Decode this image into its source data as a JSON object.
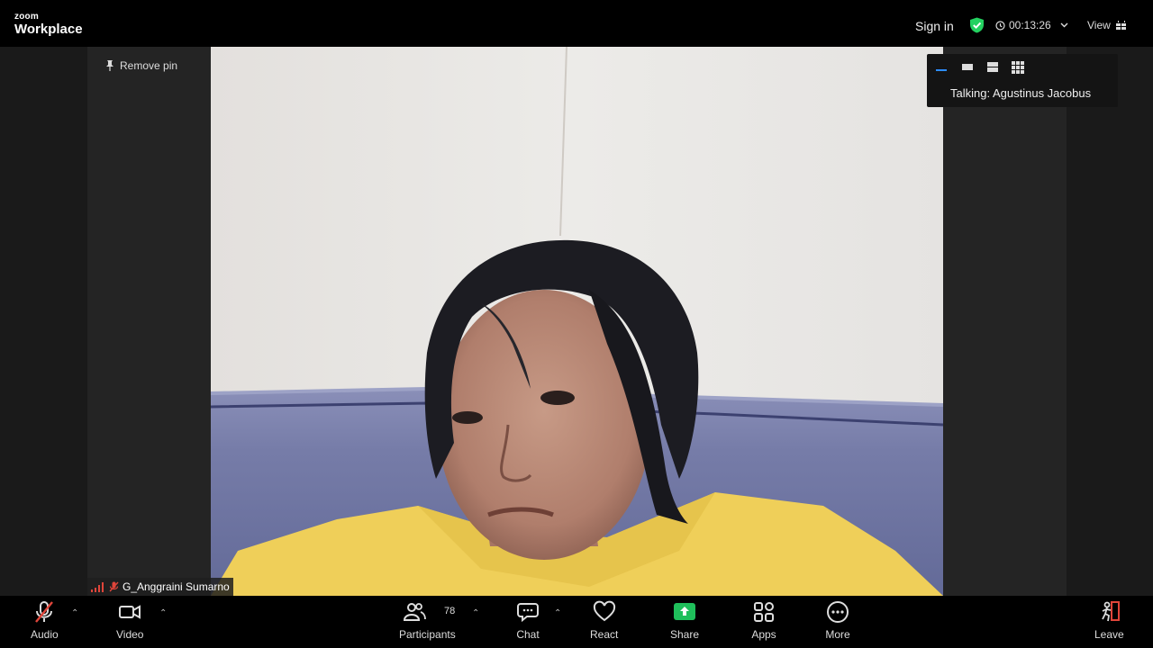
{
  "app": {
    "brand_small": "zoom",
    "brand_big": "Workplace"
  },
  "topbar": {
    "sign_in": "Sign in",
    "timer": "00:13:26",
    "view_label": "View"
  },
  "pin": {
    "remove_label": "Remove pin"
  },
  "participant": {
    "name": "G_Anggraini Sumarno"
  },
  "talking": {
    "text": "Talking: Agustinus Jacobus"
  },
  "toolbar": {
    "audio": "Audio",
    "video": "Video",
    "participants": "Participants",
    "participants_count": "78",
    "chat": "Chat",
    "react": "React",
    "share": "Share",
    "apps": "Apps",
    "more": "More",
    "leave": "Leave"
  },
  "colors": {
    "secure_green": "#23d160",
    "share_green": "#1fbf5b",
    "muted_red": "#e0453a",
    "active_blue": "#2d8cff"
  }
}
